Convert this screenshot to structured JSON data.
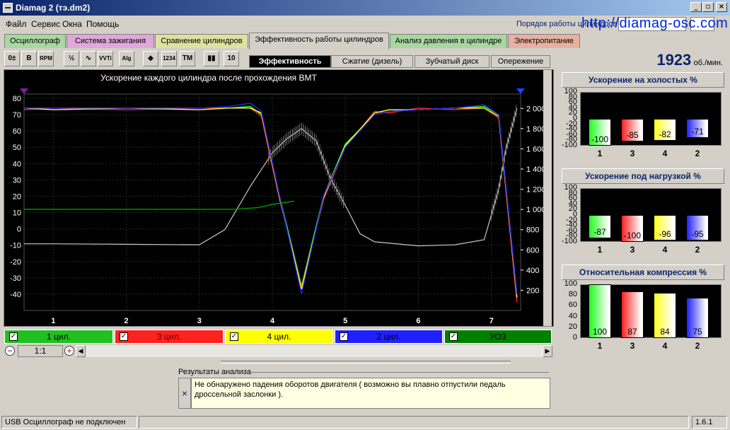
{
  "window": {
    "title": "Diamag 2 (тэ.dm2)",
    "min_glyph": "_",
    "max_glyph": "▫",
    "close_glyph": "×"
  },
  "menu": [
    "Файл",
    "Сервис",
    "Окна",
    "Помощь"
  ],
  "order_label": "Порядок работы цилиндров",
  "website": "http://diamag-osc.com",
  "tabs": [
    {
      "label": "Осциллограф",
      "color": "#a8d8a0"
    },
    {
      "label": "Система зажигания",
      "color": "#e0a8d8"
    },
    {
      "label": "Сравнение цилиндров",
      "color": "#e0e0a0"
    },
    {
      "label": "Эффективность работы цилиндров",
      "color": "#d4d0c8"
    },
    {
      "label": "Анализ давления в цилиндре",
      "color": "#a8d8a0"
    },
    {
      "label": "Электропитание",
      "color": "#e8b0a0"
    }
  ],
  "toolbar": [
    {
      "icon": "zero-adjust-icon",
      "glyph": "0±"
    },
    {
      "icon": "bold-icon",
      "glyph": "B"
    },
    {
      "icon": "rpm-icon",
      "glyph": "RPM"
    },
    {
      "icon": "scale-icon",
      "glyph": "½"
    },
    {
      "icon": "line-graph-icon",
      "glyph": "∿"
    },
    {
      "icon": "vvti-icon",
      "glyph": "VVTi"
    },
    {
      "icon": "algorithm-icon",
      "glyph": "Alg"
    },
    {
      "icon": "sensor-icon",
      "glyph": "◈"
    },
    {
      "icon": "cylinder-order-icon",
      "glyph": "1234"
    },
    {
      "icon": "tdc-marker-icon",
      "glyph": "ТМ"
    },
    {
      "icon": "bar-chart-icon",
      "glyph": "▮▮"
    },
    {
      "icon": "scale-bar-icon",
      "glyph": "10"
    }
  ],
  "subtabs": [
    "Эффективность",
    "Сжатие (дизель)",
    "Зубчатый диск",
    "Опережение"
  ],
  "rpm": {
    "value": "1923",
    "unit": "об./мин."
  },
  "chart_data": {
    "type": "line",
    "title": "Ускорение каждого цилиндра после прохождения ВМТ",
    "xlim": [
      0.6,
      7.4
    ],
    "ylim_left": [
      -50,
      80
    ],
    "ylim_right": [
      0,
      2100
    ],
    "x_ticks": [
      "1",
      "2",
      "3",
      "4",
      "5",
      "6",
      "7"
    ],
    "y_ticks_left": [
      "80",
      "70",
      "60",
      "50",
      "40",
      "30",
      "20",
      "10",
      "0",
      "-10",
      "-20",
      "-30",
      "-40"
    ],
    "y_ticks_right": [
      "2 000",
      "1 800",
      "1 600",
      "1 400",
      "1 200",
      "1 000",
      "800",
      "600",
      "400",
      "200"
    ],
    "series": [
      {
        "name": "1 цил.",
        "color": "#20ff20",
        "x": [
          0.6,
          1,
          2,
          3,
          3.4,
          3.7,
          3.85,
          4.1,
          4.4,
          4.7,
          5.0,
          5.4,
          5.6,
          6,
          6.5,
          6.9,
          7.1,
          7.35
        ],
        "y": [
          74,
          74,
          74,
          74,
          74,
          75,
          70,
          20,
          -35,
          20,
          52,
          70,
          72,
          73,
          74,
          75,
          70,
          -40
        ]
      },
      {
        "name": "3 цил.",
        "color": "#ff2020",
        "x": [
          0.6,
          1,
          2,
          3,
          3.4,
          3.7,
          3.85,
          4.1,
          4.4,
          4.7,
          5.0,
          5.4,
          5.6,
          6,
          6.5,
          6.9,
          7.1,
          7.35
        ],
        "y": [
          73,
          74,
          73,
          74,
          74,
          74,
          69,
          18,
          -36,
          18,
          50,
          72,
          71,
          74,
          73,
          74,
          68,
          -45
        ]
      },
      {
        "name": "4 цил.",
        "color": "#ffff20",
        "x": [
          0.6,
          1,
          2,
          3,
          3.4,
          3.7,
          3.85,
          4.1,
          4.4,
          4.7,
          5.0,
          5.4,
          5.6,
          6,
          6.5,
          6.9,
          7.1,
          7.35
        ],
        "y": [
          74,
          73,
          74,
          73,
          74,
          74,
          71,
          19,
          -37,
          19,
          51,
          71,
          73,
          73,
          74,
          74,
          69,
          -42
        ]
      },
      {
        "name": "2 цил.",
        "color": "#2020ff",
        "x": [
          0.6,
          1,
          2,
          3,
          3.4,
          3.7,
          3.85,
          4.1,
          4.4,
          4.7,
          5.0,
          5.4,
          5.6,
          6,
          6.5,
          6.9,
          7.1,
          7.35
        ],
        "y": [
          74,
          74,
          74,
          74,
          75,
          77,
          72,
          20,
          -40,
          20,
          50,
          70,
          72,
          73,
          74,
          76,
          70,
          -40
        ]
      },
      {
        "name": "УОЗ",
        "color": "#00a000",
        "x": [
          0.6,
          1,
          2,
          3,
          3.5,
          3.8,
          4.0,
          4.3
        ],
        "y": [
          12,
          12,
          12,
          12,
          12,
          13,
          15,
          17
        ]
      }
    ],
    "rpm_series": {
      "name": "RPM",
      "color": "#c8c8c8",
      "axis": "right",
      "x": [
        0.6,
        1,
        2,
        3,
        3.35,
        3.7,
        4.0,
        4.2,
        4.4,
        4.6,
        4.8,
        5.0,
        5.2,
        5.4,
        6,
        6.5,
        6.9,
        7.1,
        7.2,
        7.35
      ],
      "y": [
        660,
        660,
        655,
        650,
        800,
        1230,
        1560,
        1700,
        1800,
        1680,
        1300,
        1040,
        760,
        680,
        640,
        650,
        700,
        1200,
        1600,
        2000
      ]
    }
  },
  "legend": [
    {
      "label": "1 цил.",
      "color": "#20c020",
      "text_color": "#000"
    },
    {
      "label": "3 цил.",
      "color": "#ff2020",
      "text_color": "#600"
    },
    {
      "label": "4 цил.",
      "color": "#ffff00",
      "text_color": "#000"
    },
    {
      "label": "2 цил.",
      "color": "#2020ff",
      "text_color": "#000"
    },
    {
      "label": "УОЗ",
      "color": "#008000",
      "text_color": "#000"
    }
  ],
  "zoom": {
    "value": "1:1",
    "minus_glyph": "−",
    "plus_glyph": "+",
    "left_glyph": "◀",
    "right_glyph": "▶"
  },
  "results": {
    "title": "Результаты анализа",
    "text": "Не обнаружено падения оборотов двигателя ( возможно вы плавно отпустили педаль дроссельной заслонки ).",
    "close_glyph": "×"
  },
  "status": {
    "left": "USB Осциллограф не подключен",
    "version": "1.6.1"
  },
  "panels": [
    {
      "title": "Ускорение на холостых %",
      "ylim": [
        -100,
        100
      ],
      "ticks": [
        "100",
        "80",
        "60",
        "40",
        "20",
        "0",
        "-20",
        "-40",
        "-60",
        "-80",
        "-100"
      ],
      "bars": [
        {
          "cat": "1",
          "value": -100,
          "color": "#20ff20"
        },
        {
          "cat": "3",
          "value": -85,
          "color": "#ff2020"
        },
        {
          "cat": "4",
          "value": -82,
          "color": "#ffff20"
        },
        {
          "cat": "2",
          "value": -71,
          "color": "#2020ff"
        }
      ]
    },
    {
      "title": "Ускорение под нагрузкой %",
      "ylim": [
        -100,
        100
      ],
      "ticks": [
        "100",
        "80",
        "60",
        "40",
        "20",
        "0",
        "-20",
        "-40",
        "-60",
        "-80",
        "-100"
      ],
      "bars": [
        {
          "cat": "1",
          "value": -87,
          "color": "#20ff20"
        },
        {
          "cat": "3",
          "value": -100,
          "color": "#ff2020"
        },
        {
          "cat": "4",
          "value": -96,
          "color": "#ffff20"
        },
        {
          "cat": "2",
          "value": -95,
          "color": "#2020ff"
        }
      ]
    },
    {
      "title": "Относительная компрессия %",
      "ylim": [
        0,
        100
      ],
      "ticks": [
        "100",
        "80",
        "60",
        "40",
        "20",
        "0"
      ],
      "bars": [
        {
          "cat": "1",
          "value": 100,
          "color": "#20ff20"
        },
        {
          "cat": "3",
          "value": 87,
          "color": "#ff2020"
        },
        {
          "cat": "4",
          "value": 84,
          "color": "#ffff20"
        },
        {
          "cat": "2",
          "value": 75,
          "color": "#2020ff"
        }
      ]
    }
  ]
}
